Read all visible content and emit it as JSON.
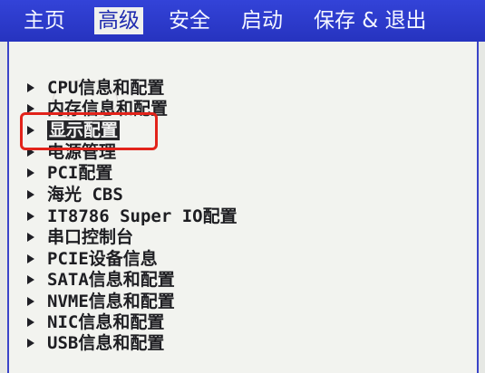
{
  "tabs": [
    {
      "label": "主页"
    },
    {
      "label": "高级"
    },
    {
      "label": "安全"
    },
    {
      "label": "启动"
    },
    {
      "label": "保存 & 退出"
    }
  ],
  "active_tab": "高级",
  "menu": [
    {
      "label": "CPU信息和配置"
    },
    {
      "label": "内存信息和配置"
    },
    {
      "label": "显示配置",
      "selected": true
    },
    {
      "label": "电源管理"
    },
    {
      "label": "PCI配置"
    },
    {
      "label": "海光 CBS"
    },
    {
      "label": "IT8786 Super IO配置"
    },
    {
      "label": "串口控制台"
    },
    {
      "label": "PCIE设备信息"
    },
    {
      "label": "SATA信息和配置"
    },
    {
      "label": "NVME信息和配置"
    },
    {
      "label": "NIC信息和配置"
    },
    {
      "label": "USB信息和配置"
    }
  ],
  "colors": {
    "header_blue": "#2a37c8",
    "panel_bg": "#f2f3ef",
    "selected_bg": "#26262a",
    "annotation_red": "#e2231a"
  }
}
